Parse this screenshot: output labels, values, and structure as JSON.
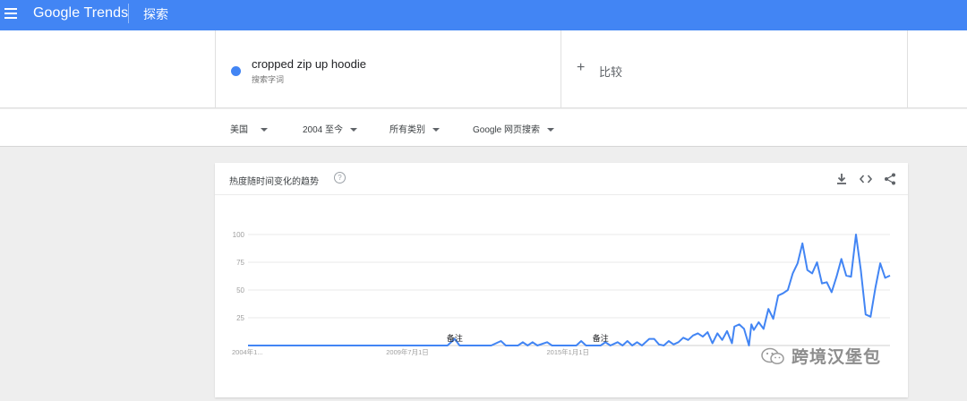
{
  "header": {
    "brand": "Google Trends",
    "explore": "探索"
  },
  "term": {
    "name": "cropped zip up hoodie",
    "type": "搜索字词",
    "color": "#4285f4"
  },
  "compare": {
    "plus": "+",
    "label": "比较"
  },
  "filters": {
    "region": "美国",
    "time": "2004 至今",
    "category": "所有类别",
    "search_type": "Google 网页搜索"
  },
  "card": {
    "title": "热度随时间变化的趋势",
    "help": "?"
  },
  "watermark": {
    "text": "跨境汉堡包"
  },
  "chart_data": {
    "type": "line",
    "title": "",
    "xlabel": "",
    "ylabel": "",
    "ylim": [
      0,
      100
    ],
    "yticks": [
      25,
      50,
      75,
      100
    ],
    "xtick_labels": [
      {
        "x": 0,
        "label": "2004年1..."
      },
      {
        "x": 66,
        "label": "2009年7月1日"
      },
      {
        "x": 132,
        "label": "2015年1月1日"
      }
    ],
    "annotations": [
      {
        "x": 85,
        "label": "备注"
      },
      {
        "x": 145,
        "label": "备注"
      }
    ],
    "grid": true,
    "legend": "none",
    "series": [
      {
        "color": "#4285f4",
        "points": [
          [
            0,
            0
          ],
          [
            60,
            0
          ],
          [
            82,
            0
          ],
          [
            85,
            6
          ],
          [
            87,
            0
          ],
          [
            100,
            0
          ],
          [
            104,
            4
          ],
          [
            106,
            0
          ],
          [
            111,
            0
          ],
          [
            113,
            3
          ],
          [
            115,
            0
          ],
          [
            117,
            3
          ],
          [
            119,
            0
          ],
          [
            123,
            3
          ],
          [
            125,
            0
          ],
          [
            135,
            0
          ],
          [
            137,
            4
          ],
          [
            139,
            0
          ],
          [
            145,
            0
          ],
          [
            147,
            3
          ],
          [
            149,
            0
          ],
          [
            152,
            3
          ],
          [
            154,
            0
          ],
          [
            156,
            4
          ],
          [
            158,
            0
          ],
          [
            160,
            3
          ],
          [
            162,
            0
          ],
          [
            165,
            6
          ],
          [
            167,
            6
          ],
          [
            169,
            1
          ],
          [
            171,
            0
          ],
          [
            173,
            4
          ],
          [
            175,
            1
          ],
          [
            177,
            3
          ],
          [
            179,
            7
          ],
          [
            181,
            5
          ],
          [
            183,
            9
          ],
          [
            185,
            11
          ],
          [
            187,
            8
          ],
          [
            189,
            12
          ],
          [
            191,
            2
          ],
          [
            193,
            11
          ],
          [
            195,
            5
          ],
          [
            197,
            13
          ],
          [
            199,
            2
          ],
          [
            200,
            17
          ],
          [
            202,
            19
          ],
          [
            204,
            15
          ],
          [
            206,
            0
          ],
          [
            207,
            19
          ],
          [
            208,
            14
          ],
          [
            210,
            21
          ],
          [
            212,
            15
          ],
          [
            214,
            33
          ],
          [
            216,
            24
          ],
          [
            218,
            45
          ],
          [
            220,
            47
          ],
          [
            222,
            50
          ],
          [
            224,
            65
          ],
          [
            226,
            74
          ],
          [
            228,
            92
          ],
          [
            230,
            68
          ],
          [
            232,
            65
          ],
          [
            234,
            75
          ],
          [
            236,
            56
          ],
          [
            238,
            57
          ],
          [
            240,
            48
          ],
          [
            242,
            62
          ],
          [
            244,
            78
          ],
          [
            246,
            63
          ],
          [
            248,
            62
          ],
          [
            250,
            100
          ],
          [
            252,
            68
          ],
          [
            254,
            28
          ],
          [
            256,
            26
          ],
          [
            258,
            52
          ],
          [
            260,
            74
          ],
          [
            262,
            61
          ],
          [
            264,
            63
          ]
        ]
      }
    ]
  }
}
